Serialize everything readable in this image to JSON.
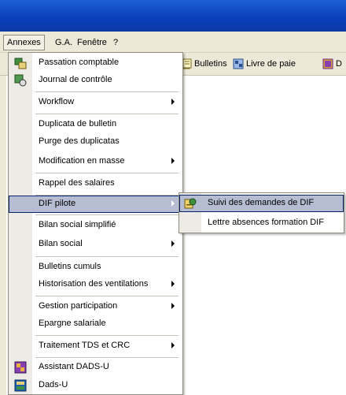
{
  "menubar": {
    "items": [
      "Annexes",
      "G.A.",
      "Fenêtre",
      "?"
    ]
  },
  "toolbar": {
    "buttons": [
      {
        "label": "Bulletins",
        "icon": "bulletins-icon"
      },
      {
        "label": "Livre de paie",
        "icon": "livre-de-paie-icon"
      },
      {
        "label": "D",
        "icon": "dads-icon"
      }
    ]
  },
  "menu": {
    "items": [
      {
        "label": "Passation comptable",
        "icon": "passation-icon"
      },
      {
        "label": "Journal de contrôle",
        "icon": "journal-icon"
      },
      {
        "label": "Workflow",
        "submenu": true
      },
      {
        "label": "Duplicata de bulletin"
      },
      {
        "label": "Purge des duplicatas"
      },
      {
        "label": "Modification en masse",
        "submenu": true
      },
      {
        "label": "Rappel des salaires"
      },
      {
        "label": "DIF pilote",
        "submenu": true,
        "highlighted": true
      },
      {
        "label": "Bilan social simplifié"
      },
      {
        "label": "Bilan social",
        "submenu": true
      },
      {
        "label": "Bulletins cumuls"
      },
      {
        "label": "Historisation des ventilations",
        "submenu": true
      },
      {
        "label": "Gestion participation",
        "submenu": true
      },
      {
        "label": "Epargne salariale"
      },
      {
        "label": "Traitement TDS et CRC",
        "submenu": true
      },
      {
        "label": "Assistant DADS-U",
        "icon": "assistant-dads-icon"
      },
      {
        "label": "Dads-U",
        "icon": "dads-u-icon"
      }
    ]
  },
  "submenu": {
    "items": [
      {
        "label": "Suivi des demandes de DIF",
        "icon": "suivi-dif-icon",
        "highlighted": true
      },
      {
        "label": "Lettre absences formation DIF"
      }
    ]
  },
  "colors": {
    "titlebar": "#0a3fb8",
    "menu_highlight": "#b6bdd2",
    "menubar": "#ece9d8"
  }
}
